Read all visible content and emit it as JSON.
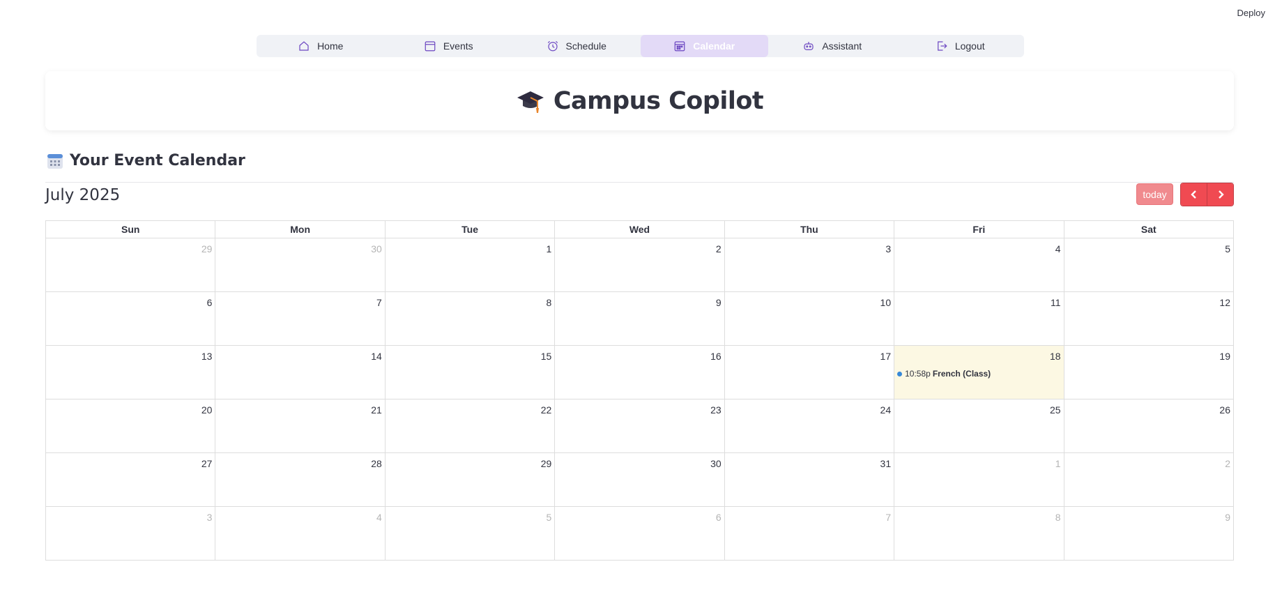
{
  "top": {
    "deploy_label": "Deploy"
  },
  "nav": {
    "items": [
      {
        "label": "Home",
        "icon": "home-icon"
      },
      {
        "label": "Events",
        "icon": "calendar-outline-icon"
      },
      {
        "label": "Schedule",
        "icon": "alarm-clock-icon"
      },
      {
        "label": "Calendar",
        "icon": "calendar-grid-icon",
        "active": true
      },
      {
        "label": "Assistant",
        "icon": "robot-icon"
      },
      {
        "label": "Logout",
        "icon": "logout-icon"
      }
    ],
    "accent_color": "#6b46c1",
    "active_bg": "#e3daf7"
  },
  "header": {
    "title": "Campus Copilot",
    "icon": "graduation-cap-icon"
  },
  "section": {
    "title": "Your Event Calendar",
    "icon": "calendar-icon"
  },
  "calendar": {
    "month_title": "July 2025",
    "today_label": "today",
    "prev_icon": "chevron-left-icon",
    "next_icon": "chevron-right-icon",
    "button_color": "#f04a52",
    "weekdays": [
      "Sun",
      "Mon",
      "Tue",
      "Wed",
      "Thu",
      "Fri",
      "Sat"
    ],
    "weeks": [
      [
        {
          "d": "29",
          "o": true
        },
        {
          "d": "30",
          "o": true
        },
        {
          "d": "1"
        },
        {
          "d": "2"
        },
        {
          "d": "3"
        },
        {
          "d": "4"
        },
        {
          "d": "5"
        }
      ],
      [
        {
          "d": "6"
        },
        {
          "d": "7"
        },
        {
          "d": "8"
        },
        {
          "d": "9"
        },
        {
          "d": "10"
        },
        {
          "d": "11"
        },
        {
          "d": "12"
        }
      ],
      [
        {
          "d": "13"
        },
        {
          "d": "14"
        },
        {
          "d": "15"
        },
        {
          "d": "16"
        },
        {
          "d": "17"
        },
        {
          "d": "18",
          "today": true,
          "events": [
            {
              "time": "10:58p",
              "title": "French (Class)"
            }
          ]
        },
        {
          "d": "19"
        }
      ],
      [
        {
          "d": "20"
        },
        {
          "d": "21"
        },
        {
          "d": "22"
        },
        {
          "d": "23"
        },
        {
          "d": "24"
        },
        {
          "d": "25"
        },
        {
          "d": "26"
        }
      ],
      [
        {
          "d": "27"
        },
        {
          "d": "28"
        },
        {
          "d": "29"
        },
        {
          "d": "30"
        },
        {
          "d": "31"
        },
        {
          "d": "1",
          "o": true
        },
        {
          "d": "2",
          "o": true
        }
      ],
      [
        {
          "d": "3",
          "o": true
        },
        {
          "d": "4",
          "o": true
        },
        {
          "d": "5",
          "o": true
        },
        {
          "d": "6",
          "o": true
        },
        {
          "d": "7",
          "o": true
        },
        {
          "d": "8",
          "o": true
        },
        {
          "d": "9",
          "o": true
        }
      ]
    ]
  }
}
